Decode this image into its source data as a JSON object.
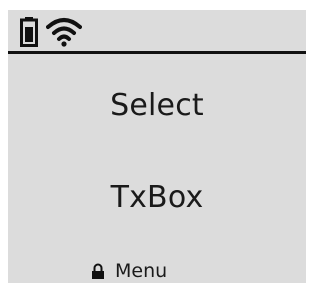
{
  "status_bar": {
    "battery_icon": "battery-icon",
    "wifi_icon": "wifi-icon"
  },
  "main": {
    "line1": "Select",
    "line2": "TxBox"
  },
  "footer": {
    "lock_icon": "lock-icon",
    "hint_label": "Menu"
  },
  "colors": {
    "screen_background": "#dcdcdc",
    "foreground": "#1a1a1a",
    "divider": "#111111"
  }
}
